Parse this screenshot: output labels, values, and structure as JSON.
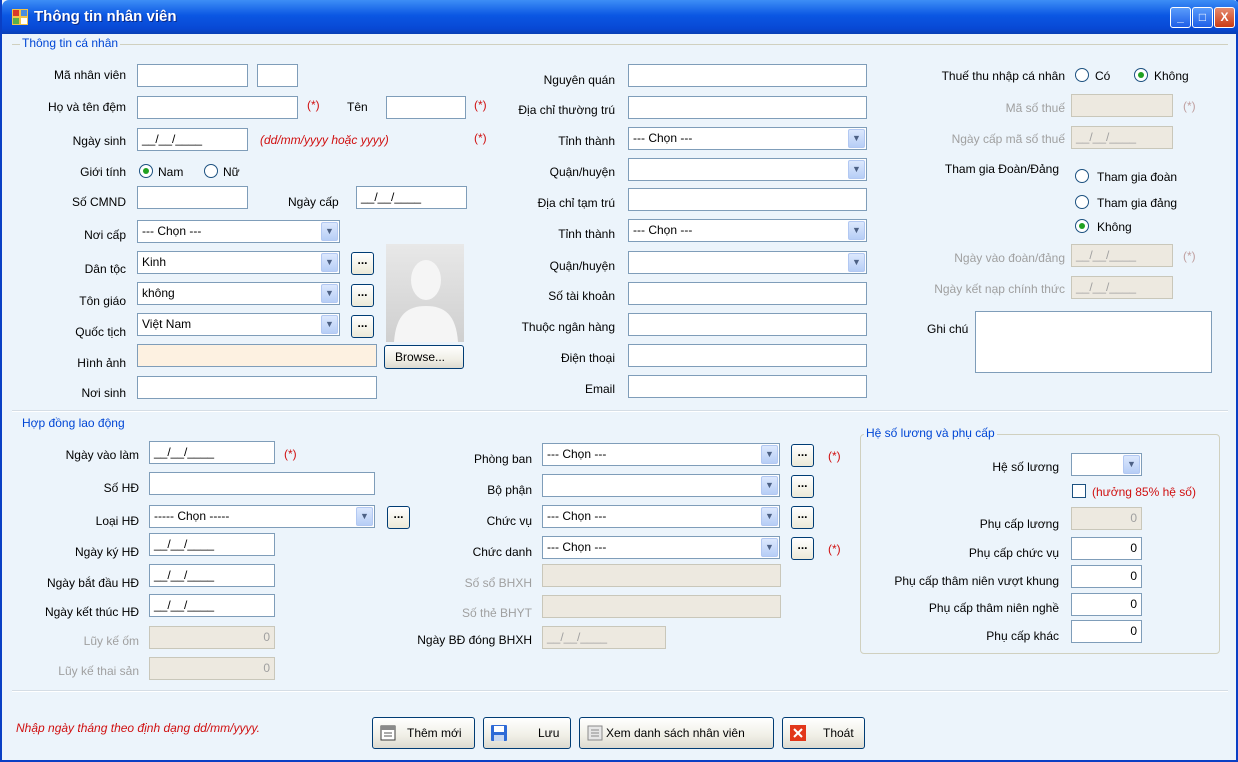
{
  "window": {
    "title": "Thông tin nhân viên",
    "btn_min": "_",
    "btn_max": "□",
    "btn_close": "X"
  },
  "personal": {
    "group_title": "Thông tin cá nhân",
    "employee_id_label": "Mã nhân viên",
    "lastname_label": "Họ và tên đệm",
    "required_mark": "(*)",
    "firstname_label": "Tên",
    "birthdate_label": "Ngày sinh",
    "date_mask": "__/__/____",
    "date_hint": "(dd/mm/yyyy hoặc yyyy)",
    "gender_label": "Giới tính",
    "gender_male": "Nam",
    "gender_female": "Nữ",
    "id_card_label": "Số CMND",
    "issue_date_label": "Ngày cấp",
    "issue_place_label": "Nơi cấp",
    "choose": "--- Chọn ---",
    "ethnicity_label": "Dân tộc",
    "ethnicity_value": "Kinh",
    "religion_label": "Tôn giáo",
    "religion_value": "không",
    "nationality_label": "Quốc tịch",
    "nationality_value": "Việt Nam",
    "image_label": "Hình ảnh",
    "browse_button": "Browse...",
    "birthplace_label": "Nơi sinh",
    "hometown_label": "Nguyên quán",
    "permanent_address_label": "Địa chỉ thường trú",
    "province_label": "Tỉnh thành",
    "district_label": "Quận/huyện",
    "temp_address_label": "Địa chỉ tạm trú",
    "account_label": "Số tài khoản",
    "bank_label": "Thuộc ngân hàng",
    "phone_label": "Điện thoại",
    "email_label": "Email",
    "income_tax_label": "Thuế thu nhập cá nhân",
    "tax_yes": "Có",
    "tax_no": "Không",
    "tax_code_label": "Mã số thuế",
    "tax_code_date_label": "Ngày cấp mã số thuế",
    "union_label": "Tham gia Đoàn/Đảng",
    "union_opt1": "Tham gia đoàn",
    "union_opt2": "Tham gia đảng",
    "union_opt3": "Không",
    "union_date_label": "Ngày vào đoàn/đảng",
    "official_date_label": "Ngày kết nạp chính thức",
    "note_label": "Ghi chú"
  },
  "contract": {
    "group_title": "Hợp đồng lao động",
    "start_work_label": "Ngày vào làm",
    "contract_no_label": "Số HĐ",
    "contract_type_label": "Loại HĐ",
    "contract_type_value": "----- Chọn -----",
    "sign_date_label": "Ngày ký HĐ",
    "begin_date_label": "Ngày bắt đầu HĐ",
    "end_date_label": "Ngày kết thúc HĐ",
    "sick_label": "Lũy kế ốm",
    "sick_value": "0",
    "maternity_label": "Lũy kế thai sản",
    "maternity_value": "0",
    "department_label": "Phòng ban",
    "section_label": "Bộ phận",
    "position_label": "Chức vụ",
    "title_label": "Chức danh",
    "social_ins_label": "Số sổ BHXH",
    "health_ins_label": "Số thẻ BHYT",
    "ins_start_label": "Ngày BĐ đóng BHXH"
  },
  "salary": {
    "group_title": "Hệ số lương và phụ cấp",
    "coef_label": "Hệ số lương",
    "percent_label": "(hưởng 85% hệ số)",
    "salary_allow_label": "Phụ cấp lương",
    "salary_allow_value": "0",
    "position_allow_label": "Phụ cấp chức vụ",
    "position_allow_value": "0",
    "seniority_over_label": "Phụ cấp thâm niên vượt khung",
    "seniority_over_value": "0",
    "seniority_label": "Phụ cấp thâm niên nghề",
    "seniority_value": "0",
    "other_label": "Phụ cấp khác",
    "other_value": "0"
  },
  "footer": {
    "hint": "Nhập ngày tháng theo định dạng dd/mm/yyyy.",
    "add_button": "Thêm mới",
    "save_button": "Lưu",
    "list_button": "Xem danh sách nhân viên",
    "exit_button": "Thoát"
  },
  "colors": {
    "title_bar": "#0b57e3",
    "required": "#d01010",
    "group_title": "#0046d5",
    "background": "#ecf4fb"
  }
}
